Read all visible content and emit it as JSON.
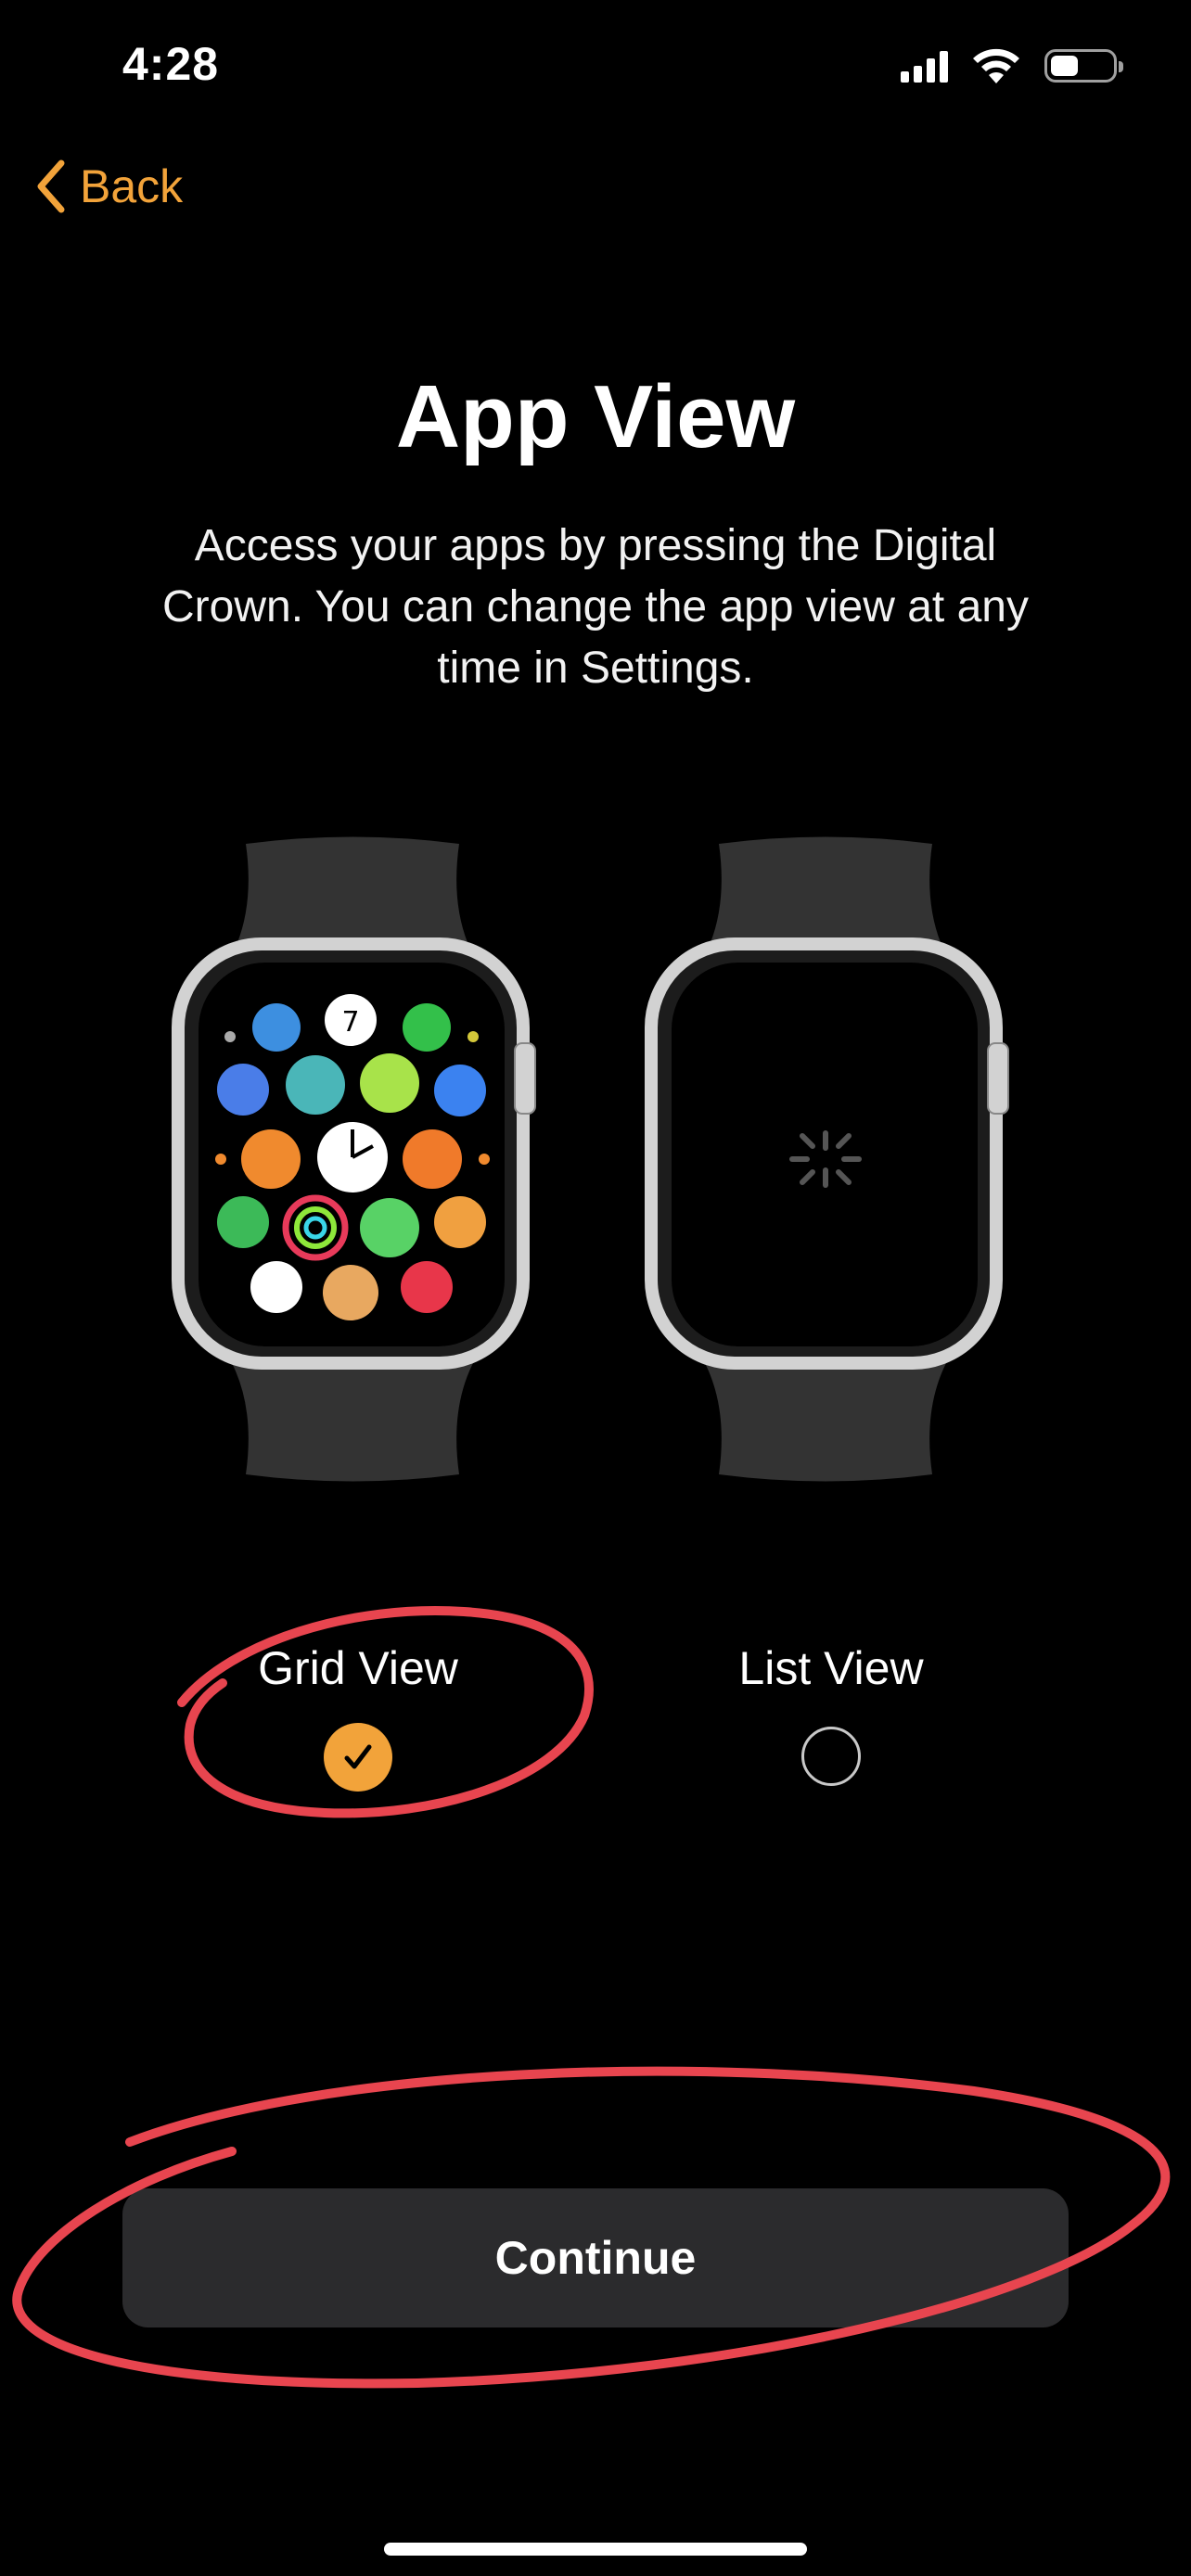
{
  "status_bar": {
    "time": "4:28",
    "battery_fraction": 0.45
  },
  "nav": {
    "back_label": "Back"
  },
  "header": {
    "title": "App View",
    "description": "Access your apps by pressing the Digital Crown. You can change the app view at any time in Settings."
  },
  "options": [
    {
      "label": "Grid View",
      "selected": true
    },
    {
      "label": "List View",
      "selected": false
    }
  ],
  "footer": {
    "continue_label": "Continue"
  },
  "colors": {
    "accent": "#f2a33a",
    "annotation": "#e8454f",
    "button_bg": "#2b2b2d"
  }
}
